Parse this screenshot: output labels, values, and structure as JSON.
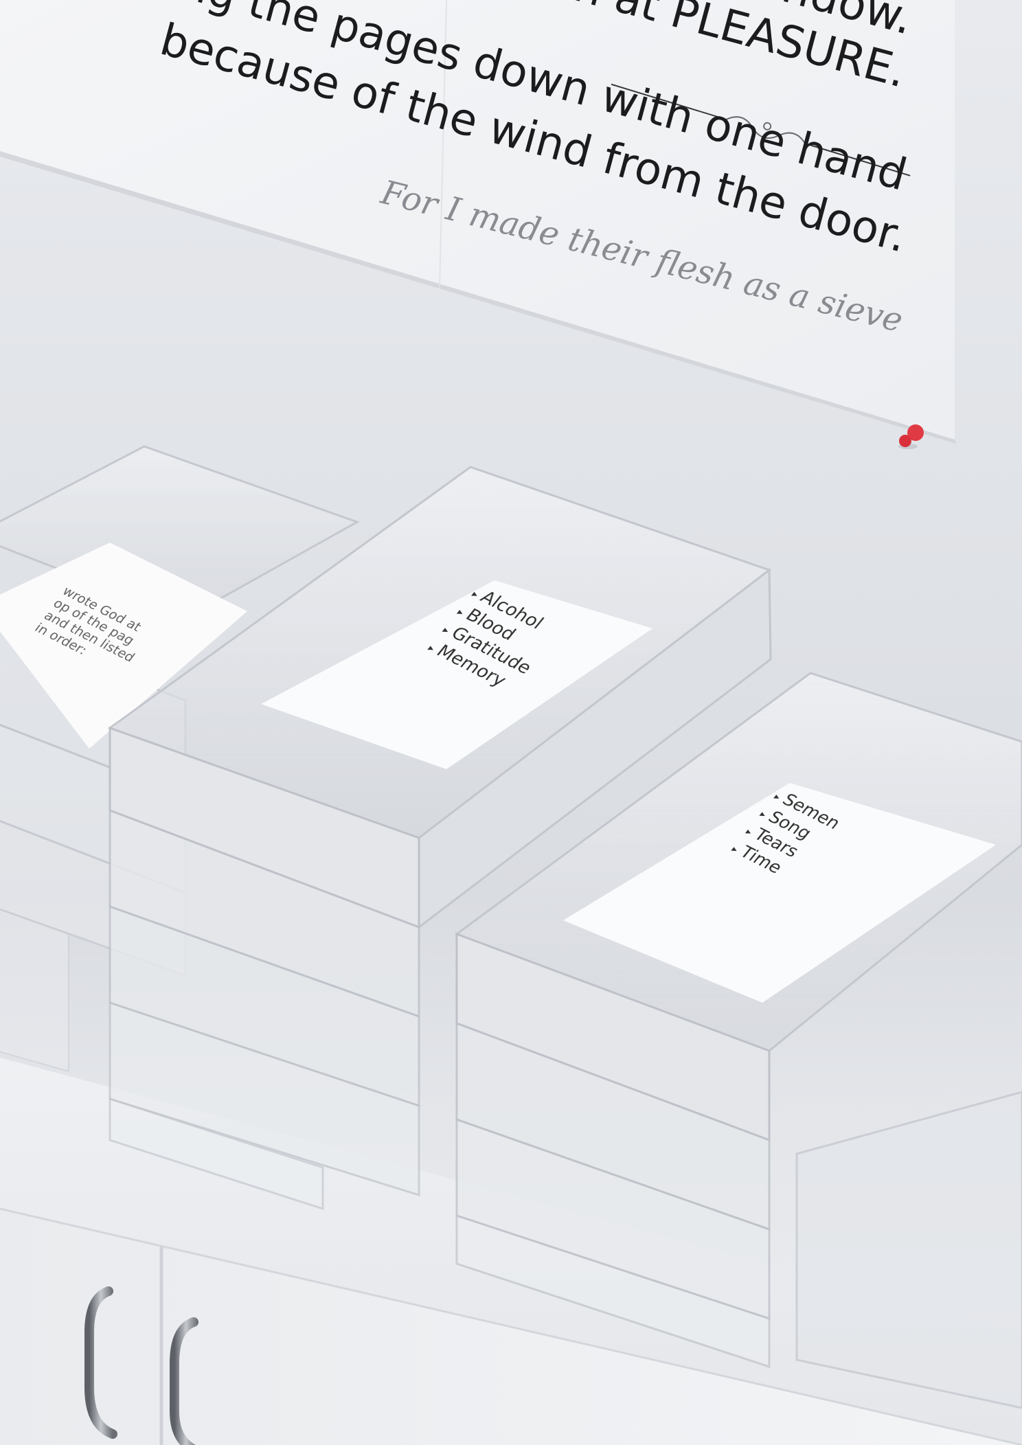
{
  "poster": {
    "line1": "the window.",
    "line2": "file open at PLEASURE.",
    "line3": "was holding the pages down with one hand",
    "line4": "because of the wind from the door.",
    "quote": "For I made their flesh as a sieve"
  },
  "cards": {
    "left_card": {
      "lines": [
        "wrote God at",
        "op of the pag",
        "and then listed",
        "in order:"
      ]
    },
    "middle_card": {
      "items": [
        "Alcohol",
        "Blood",
        "Gratitude",
        "Memory"
      ]
    },
    "right_card": {
      "items": [
        "Semen",
        "Song",
        "Tears",
        "Time"
      ]
    }
  },
  "colors": {
    "pushpin": "#e03a44",
    "wall": "#dfe2e6",
    "counter": "#eceef1"
  },
  "icons": {
    "pushpin": "pushpin-icon",
    "bullet": "triangle-bullet-icon"
  }
}
